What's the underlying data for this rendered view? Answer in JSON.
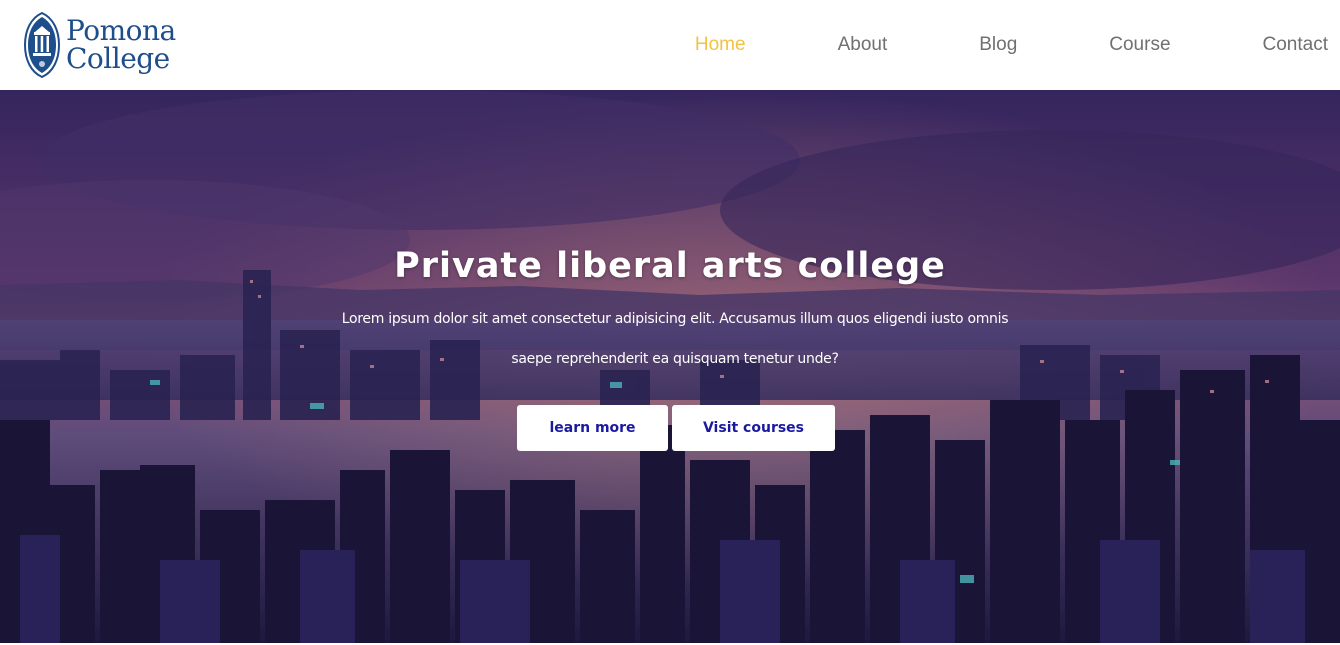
{
  "brand": {
    "line1": "Pomona",
    "line2": "College"
  },
  "nav": {
    "items": [
      {
        "label": "Home",
        "active": true
      },
      {
        "label": "About",
        "active": false
      },
      {
        "label": "Blog",
        "active": false
      },
      {
        "label": "Course",
        "active": false
      },
      {
        "label": "Contact",
        "active": false
      }
    ],
    "active_color": "#f4c242",
    "color": "#707070"
  },
  "hero": {
    "title": "Private liberal arts college",
    "text": "Lorem ipsum dolor sit amet consectetur adipisicing elit. Accusamus illum quos eligendi iusto omnis saepe reprehenderit ea quisquam tenetur unde?",
    "buttons": {
      "learn": "learn more",
      "visit": "Visit courses"
    },
    "background": "city-skyline-night-illustration"
  },
  "colors": {
    "brand_blue": "#1f4e8c",
    "button_text": "#1a1aa0"
  }
}
